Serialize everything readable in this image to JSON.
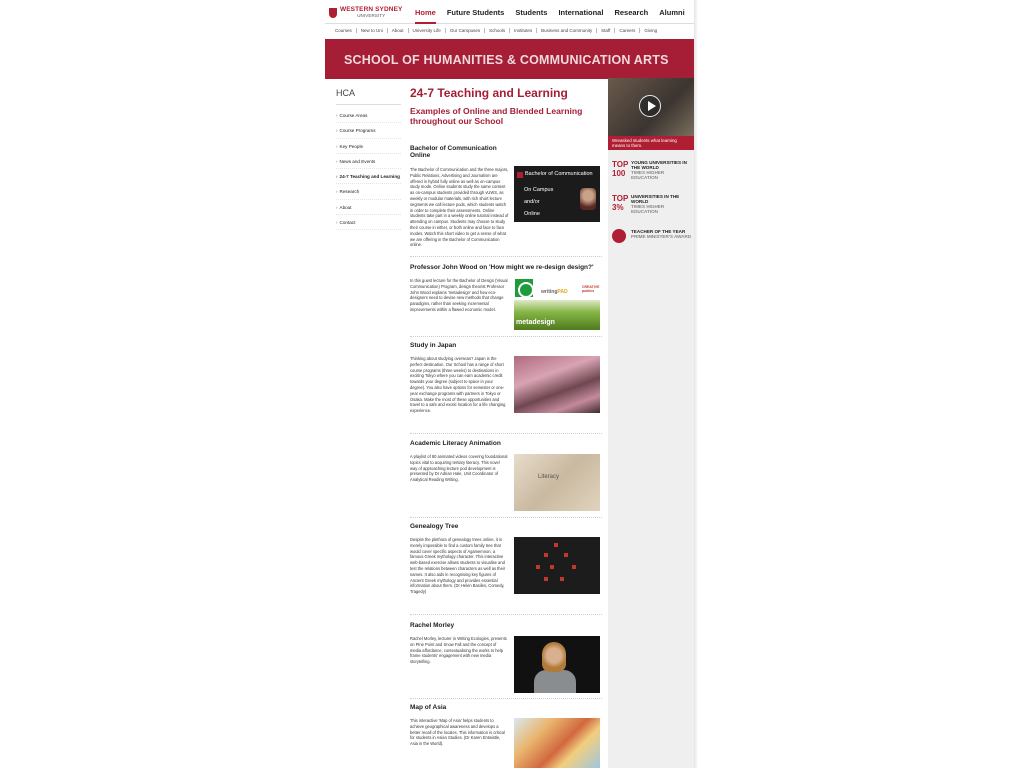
{
  "logo": {
    "name": "WESTERN SYDNEY",
    "sub": "UNIVERSITY"
  },
  "main_nav": [
    "Home",
    "Future Students",
    "Students",
    "International",
    "Research",
    "Alumni"
  ],
  "sub_nav": [
    "Courses",
    "New to Uni",
    "About",
    "University Life",
    "Our Campuses",
    "Schools",
    "Institutes",
    "Business and Community",
    "Staff",
    "Careers",
    "Giving"
  ],
  "banner": {
    "title": "SCHOOL OF HUMANITIES & COMMUNICATION ARTS"
  },
  "sidebar": {
    "title": "HCA",
    "items": [
      "Course Areas",
      "Course Programs",
      "Key People",
      "News and Events",
      "24-7 Teaching and Learning",
      "Research",
      "About",
      "Contact"
    ]
  },
  "main": {
    "title": "24-7 Teaching and Learning",
    "subtitle": "Examples of Online and Blended Learning throughout our School",
    "sections": [
      {
        "title": "Bachelor of Communication Online",
        "body": "The Bachelor of Communication and the three majors, Public Relations, Advertising and Journalism are offered in hybrid fully online as well as on-campus study mode. Online students study the same content as on-campus students provided through vUWS, as weekly or modular materials, with rich short lecture segments we call lecture pods, which students watch in order to complete their assessments. Online students take part in a weekly online tutorial instead of attending on campus. Students may choose to study their course in either, or both online and face to face modes. Watch this short video to get a sense of what we are offering in the Bachelor of Communication online.",
        "thumb": {
          "title": "Bachelor of Communication",
          "lines": [
            "On Campus",
            "and/or",
            "Online"
          ]
        }
      },
      {
        "title": "Professor John Wood on 'How might we re-design design?'",
        "body": "In this guest lecture for the Bachelor of Design (Visual Communication) Program, design theorist Professor John Wood explains 'metadesign' and how eco-designers need to devise new methods that change paradigms, rather than seeking incremental improvements within a flawed economic model.",
        "thumb": {
          "logo1": "writing",
          "logo2": "PAD",
          "logo3": "CREATIVE publics",
          "label": "metadesign"
        }
      },
      {
        "title": "Study in Japan",
        "body": "Thinking about studying overseas? Japan is the perfect destination. Our School has a range of short course programs (three weeks) to destinations in exciting Tokyo where you can earn academic credit towards your degree (subject to space in your degree). You also have options for semester or one-year exchange programs with partners in Tokyo or Osaka. Make the most of these opportunities and travel to a safe and exotic location for a life changing experience."
      },
      {
        "title": "Academic Literacy Animation",
        "body": "A playlist of 80 animated videos covering foundational topics vital to acquiring tertiary literacy. This novel way of approaching lecture pod development is presented by Dr Adrian Hale, Unit Coordinator of Analytical Reading Writing.",
        "thumb": {
          "label": "Literacy"
        }
      },
      {
        "title": "Genealogy Tree",
        "body": "Despite the plethora of genealogy trees online, it is merely impossible to find a custom family tree that would cover specific aspects of Agamemnon, a famous Greek mythology character. This interactive web-based exercise allows students to visualise and test the relations between characters as well as their names. It also aids in recognising key figures of Ancient Greek mythology and provides essential information about them. (Dr Helen Basiles, Comedy, Tragedy)"
      },
      {
        "title": "Rachel Morley",
        "body": "Rachel Morley, lecturer in Writing Ecologies, presents on Pine Point and Snow Fall and the concept of media affordance, contextualising the works to help frame students' engagement with new media storytelling."
      },
      {
        "title": "Map of Asia",
        "body": "This interactive 'Map of Asia' helps students to achieve geographical awareness and develops a better recall of the locales. This information is critical for students in Asian Studies. (Dr Karen Entwistle, Asia in the World)."
      }
    ]
  },
  "right": {
    "video_caption": "Wreasked students what learning means to them.",
    "awards": [
      {
        "big": "TOP 100",
        "line1": "YOUNG UNIVERSITIES IN THE WORLD",
        "line2": "TIMES HIGHER EDUCATION"
      },
      {
        "big": "TOP 3%",
        "line1": "UNIVERSITIES IN THE WORLD",
        "line2": "TIMES HIGHER EDUCATION"
      },
      {
        "big": "",
        "line1": "TEACHER OF THE YEAR",
        "line2": "PRIME MINISTER'S AWARD"
      }
    ]
  },
  "colors": {
    "brand": "#a51e36",
    "accent": "#b01e33",
    "sidebar_bg": "#efefef"
  }
}
